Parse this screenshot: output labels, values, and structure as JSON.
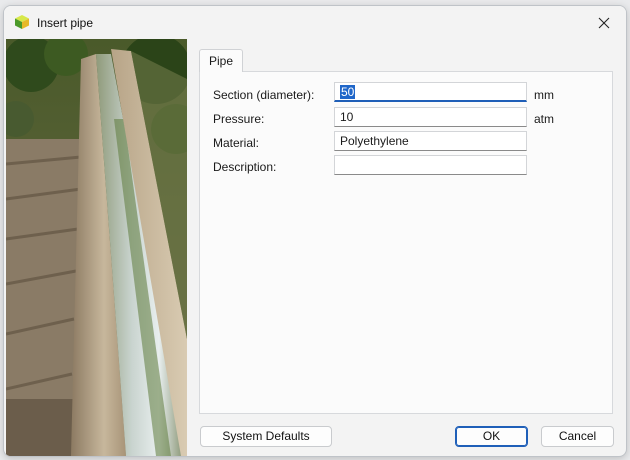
{
  "window": {
    "title": "Insert pipe"
  },
  "tabs": [
    {
      "label": "Pipe"
    }
  ],
  "form": {
    "section_label": "Section (diameter):",
    "section_value": "50",
    "section_unit": "mm",
    "pressure_label": "Pressure:",
    "pressure_value": "10",
    "pressure_unit": "atm",
    "material_label": "Material:",
    "material_value": "Polyethylene",
    "description_label": "Description:",
    "description_value": ""
  },
  "buttons": {
    "system_defaults": "System Defaults",
    "ok": "OK",
    "cancel": "Cancel"
  },
  "colors": {
    "accent": "#1f5fb8",
    "background": "#f3f3f3",
    "panel": "#fbfbfb"
  },
  "icons": {
    "app": "yellow-green-cube-icon",
    "close": "close-icon"
  }
}
